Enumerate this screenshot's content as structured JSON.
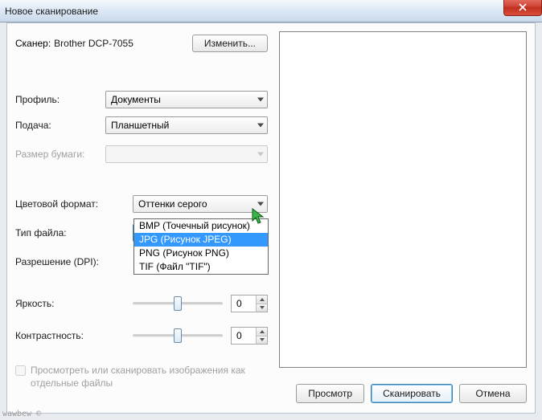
{
  "window": {
    "title": "Новое сканирование"
  },
  "scanner": {
    "label": "Сканер:",
    "name": "Brother DCP-7055",
    "change_btn": "Изменить..."
  },
  "profile": {
    "label": "Профиль:",
    "value": "Документы"
  },
  "feed": {
    "label": "Подача:",
    "value": "Планшетный"
  },
  "paper": {
    "label": "Размер бумаги:",
    "value": ""
  },
  "colorfmt": {
    "label": "Цветовой формат:",
    "value": "Оттенки серого"
  },
  "filetype": {
    "label": "Тип файла:",
    "value": "JPG (Рисунок JPEG)",
    "options": {
      "0": "BMP (Точечный рисунок)",
      "1": "JPG (Рисунок JPEG)",
      "2": "PNG (Рисунок PNG)",
      "3": "TIF (Файл \"TIF\")"
    }
  },
  "dpi": {
    "label": "Разрешение (DPI):",
    "value": ""
  },
  "brightness": {
    "label": "Яркость:",
    "value": "0"
  },
  "contrast": {
    "label": "Контрастность:",
    "value": "0"
  },
  "separate": {
    "label": "Просмотреть или сканировать изображения как отдельные файлы"
  },
  "buttons": {
    "preview": "Просмотр",
    "scan": "Сканировать",
    "cancel": "Отмена"
  },
  "watermark": "wawbew ©"
}
